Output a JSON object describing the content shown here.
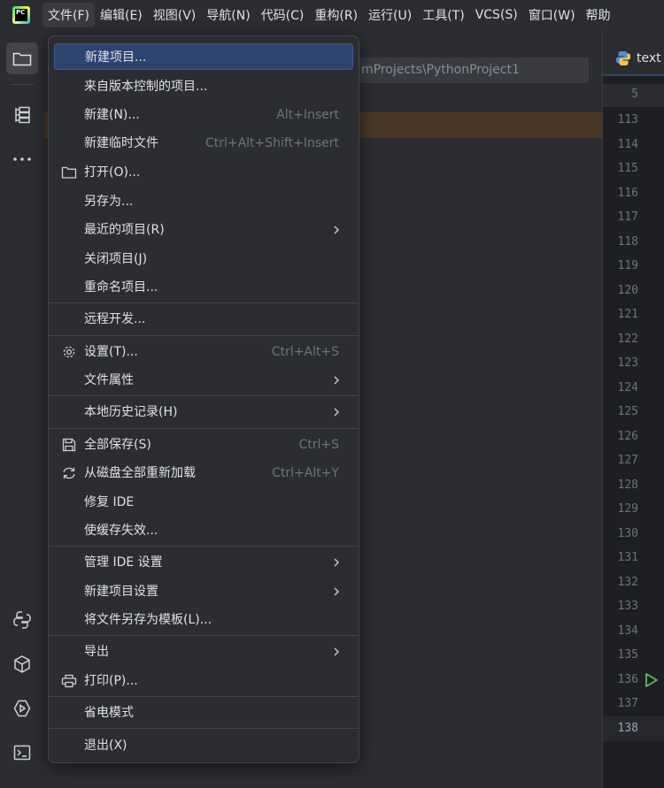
{
  "menubar": {
    "items": [
      "文件(F)",
      "编辑(E)",
      "视图(V)",
      "导航(N)",
      "代码(C)",
      "重构(R)",
      "运行(U)",
      "工具(T)",
      "VCS(S)",
      "窗口(W)",
      "帮助"
    ]
  },
  "project": {
    "path_fragment": "mProjects\\PythonProject1"
  },
  "editor": {
    "tab_label": "text",
    "sticky_line": "5",
    "line_numbers": [
      "113",
      "114",
      "115",
      "116",
      "117",
      "118",
      "119",
      "120",
      "121",
      "122",
      "123",
      "124",
      "125",
      "126",
      "127",
      "128",
      "129",
      "130",
      "131",
      "132",
      "133",
      "134",
      "135",
      "136",
      "137",
      "138"
    ],
    "current_line": "138"
  },
  "file_menu": {
    "items": [
      {
        "label": "新建项目...",
        "shortcut": "",
        "icon": "",
        "submenu": false
      },
      {
        "label": "来自版本控制的项目...",
        "shortcut": "",
        "icon": "",
        "submenu": false
      },
      {
        "label": "新建(N)...",
        "shortcut": "Alt+Insert",
        "icon": "",
        "submenu": false
      },
      {
        "label": "新建临时文件",
        "shortcut": "Ctrl+Alt+Shift+Insert",
        "icon": "",
        "submenu": false
      },
      {
        "label": "打开(O)...",
        "shortcut": "",
        "icon": "folder-icon",
        "submenu": false
      },
      {
        "label": "另存为...",
        "shortcut": "",
        "icon": "",
        "submenu": false
      },
      {
        "label": "最近的项目(R)",
        "shortcut": "",
        "icon": "",
        "submenu": true
      },
      {
        "label": "关闭项目(J)",
        "shortcut": "",
        "icon": "",
        "submenu": false
      },
      {
        "label": "重命名项目...",
        "shortcut": "",
        "icon": "",
        "submenu": false
      },
      {
        "label": "远程开发...",
        "shortcut": "",
        "icon": "",
        "submenu": false
      },
      {
        "label": "设置(T)...",
        "shortcut": "Ctrl+Alt+S",
        "icon": "gear-icon",
        "submenu": false
      },
      {
        "label": "文件属性",
        "shortcut": "",
        "icon": "",
        "submenu": true
      },
      {
        "label": "本地历史记录(H)",
        "shortcut": "",
        "icon": "",
        "submenu": true
      },
      {
        "label": "全部保存(S)",
        "shortcut": "Ctrl+S",
        "icon": "save-icon",
        "submenu": false
      },
      {
        "label": "从磁盘全部重新加载",
        "shortcut": "Ctrl+Alt+Y",
        "icon": "reload-icon",
        "submenu": false
      },
      {
        "label": "修复 IDE",
        "shortcut": "",
        "icon": "",
        "submenu": false
      },
      {
        "label": "使缓存失效...",
        "shortcut": "",
        "icon": "",
        "submenu": false
      },
      {
        "label": "管理 IDE 设置",
        "shortcut": "",
        "icon": "",
        "submenu": true
      },
      {
        "label": "新建项目设置",
        "shortcut": "",
        "icon": "",
        "submenu": true
      },
      {
        "label": "将文件另存为模板(L)...",
        "shortcut": "",
        "icon": "",
        "submenu": false
      },
      {
        "label": "导出",
        "shortcut": "",
        "icon": "",
        "submenu": true
      },
      {
        "label": "打印(P)...",
        "shortcut": "",
        "icon": "print-icon",
        "submenu": false
      },
      {
        "label": "省电模式",
        "shortcut": "",
        "icon": "",
        "submenu": false
      },
      {
        "label": "退出(X)",
        "shortcut": "",
        "icon": "",
        "submenu": false
      }
    ]
  },
  "colors": {
    "menu_bg": "#2b2d30",
    "selection": "#2e436e",
    "accent": "#3574f0",
    "run_green": "#5fb865"
  }
}
